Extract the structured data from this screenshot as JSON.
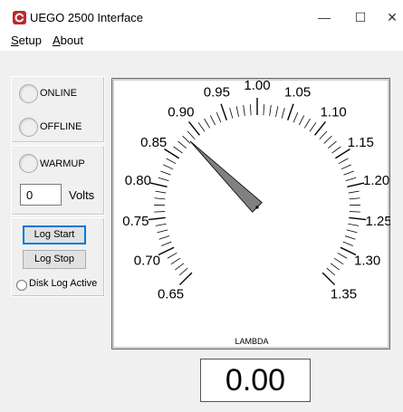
{
  "window": {
    "title": "UEGO 2500 Interface",
    "minimize_glyph": "—",
    "maximize_glyph": "☐",
    "close_glyph": "✕"
  },
  "menu": [
    {
      "label": "Setup",
      "accel": "S",
      "rest": "etup"
    },
    {
      "label": "About",
      "accel": "A",
      "rest": "bout"
    }
  ],
  "status": {
    "online": "ONLINE",
    "offline": "OFFLINE",
    "warmup": "WARMUP"
  },
  "volts": {
    "value": "0",
    "unit": "Volts"
  },
  "logging": {
    "start": "Log Start",
    "stop": "Log Stop",
    "disk": "Disk Log Active"
  },
  "gauge": {
    "label": "LAMBDA",
    "min": 0.65,
    "max": 1.35,
    "major_ticks": [
      "0.65",
      "0.70",
      "0.75",
      "0.80",
      "0.85",
      "0.90",
      "0.95",
      "1.00",
      "1.05",
      "1.10",
      "1.15",
      "1.20",
      "1.25",
      "1.30",
      "1.35"
    ],
    "needle_value": 0.8824,
    "colors": {
      "face": "#ffffff",
      "needle": "#808080"
    }
  },
  "readout": {
    "value": "0.00"
  }
}
